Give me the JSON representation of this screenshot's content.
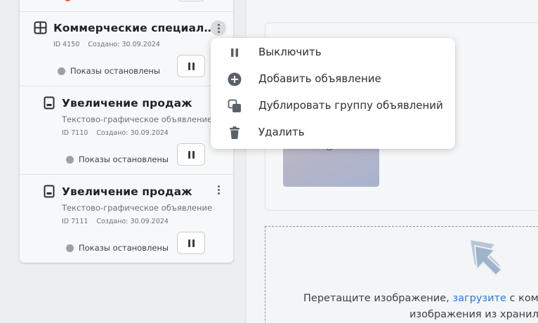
{
  "sidebar": {
    "group_item": {
      "title": "Коммерческие специал…",
      "id_text": "ID 4150",
      "created_text": "Создано: 30.09.2024",
      "status_text": "Показы остановлены"
    },
    "ad_items": [
      {
        "title": "Увеличение продаж",
        "subtitle": "Текстово-графическое объявление",
        "id_text": "ID 7110",
        "created_text": "Создано: 30.09.2024",
        "status_text": "Показы остановлены"
      },
      {
        "title": "Увеличение продаж",
        "subtitle": "Текстово-графическое объявление",
        "id_text": "ID 7111",
        "created_text": "Создано: 30.09.2024",
        "status_text": "Показы остановлены"
      }
    ]
  },
  "context_menu": {
    "items": [
      {
        "label": "Выключить",
        "icon": "pause-icon"
      },
      {
        "label": "Добавить объявление",
        "icon": "add-circle-icon"
      },
      {
        "label": "Дублировать группу объявлений",
        "icon": "duplicate-icon"
      },
      {
        "label": "Удалить",
        "icon": "trash-icon"
      }
    ]
  },
  "dropzone": {
    "text_before_link": "Перетащите изображение, ",
    "link_text": "загрузите",
    "text_after_link": " с ком",
    "line2": "изображения из хранил"
  },
  "colors": {
    "status_stopped": "#9aa0a6",
    "status_error": "#f05a1e",
    "link": "#2a7ad4",
    "menu_icon": "#5b6068"
  }
}
